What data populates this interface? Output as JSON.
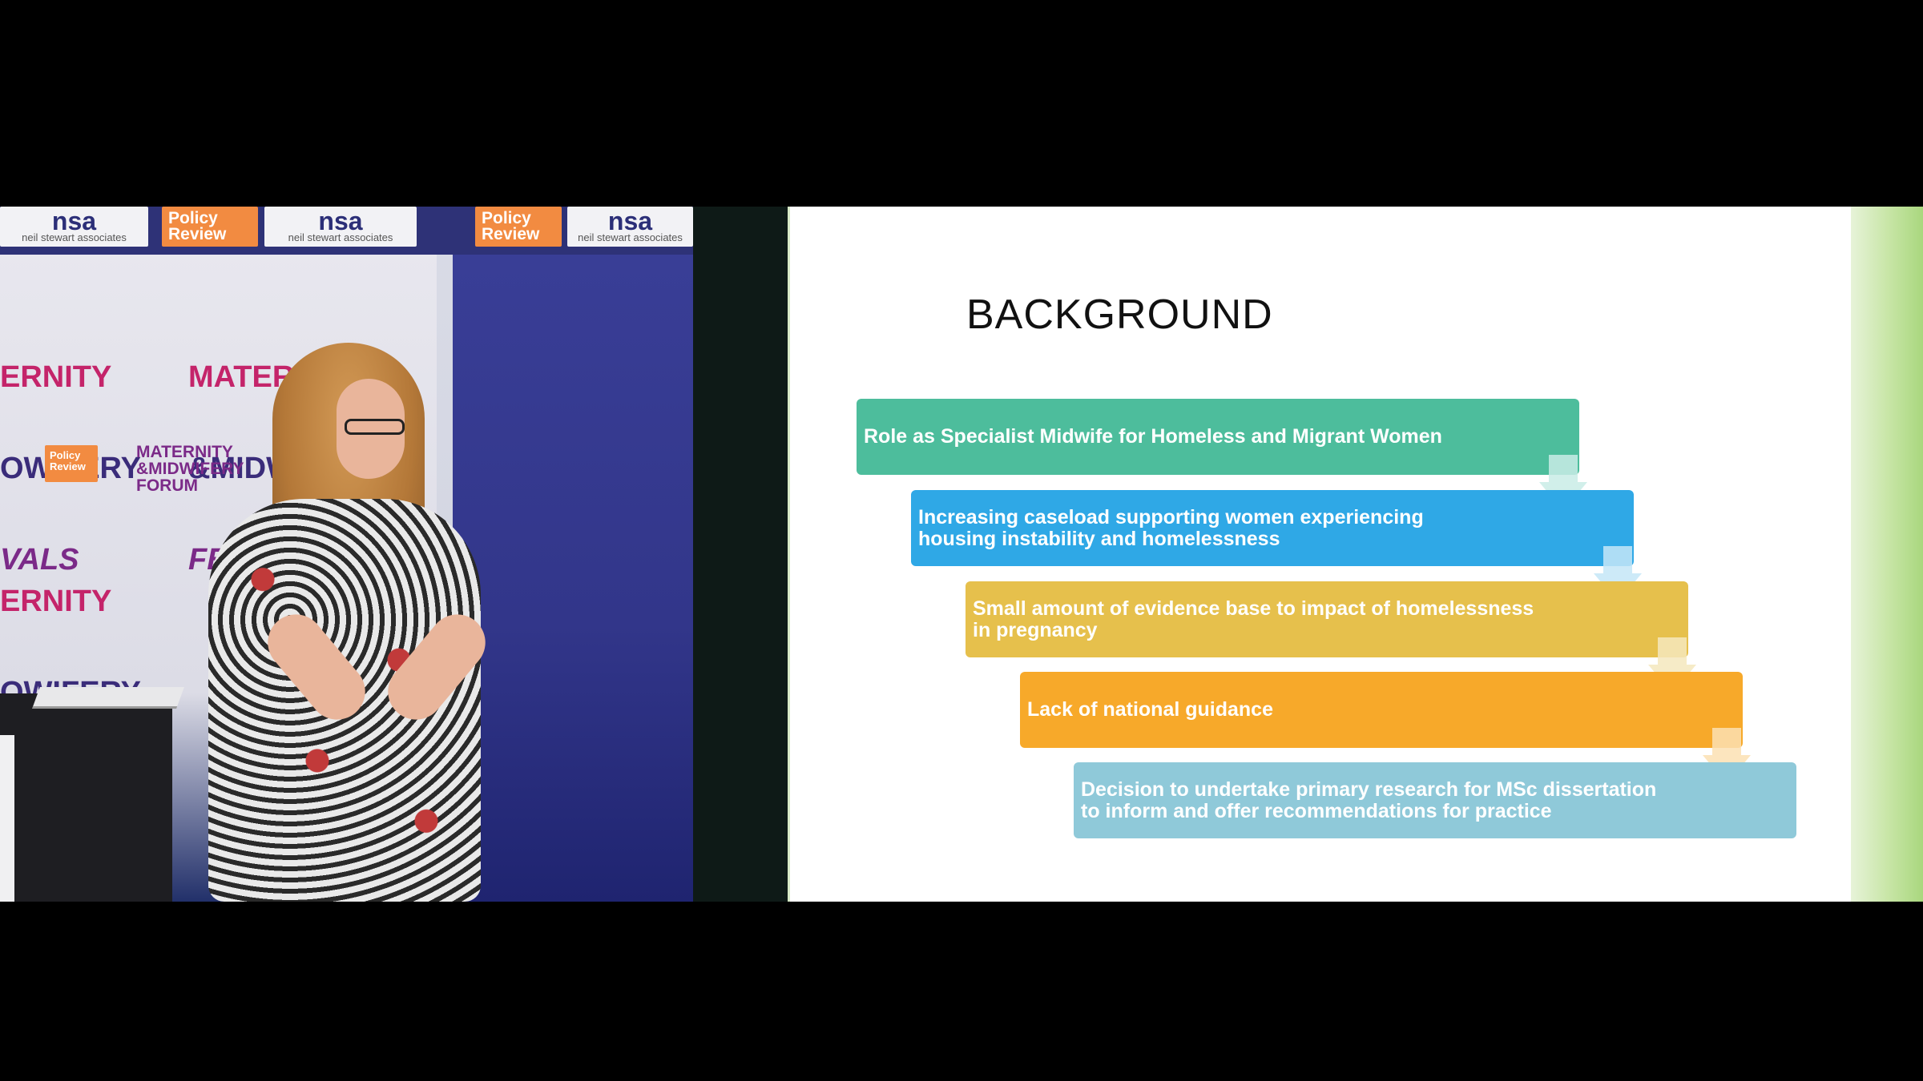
{
  "camera": {
    "sponsors": {
      "nsa_logo_text": "nsa",
      "nsa_logo_subtext": "neil stewart associates",
      "policy_logo_text": "Policy\nReview"
    },
    "backdrop": {
      "festival_line1": "ERNITY",
      "festival_line2": "OWIFERY",
      "festival_line3": "VALS",
      "festival_b_line1": "MATERNITY",
      "festival_b_line2": "&MIDWIFERY",
      "festival_b_line3": "FESTIVA",
      "forum_text": "MATERNITY\n&MIDWIFERY\nFORUM",
      "mini_policy_text": "Policy\nReview"
    }
  },
  "slide": {
    "title": "BACKGROUND",
    "steps": [
      {
        "text": "Role as Specialist Midwife for Homeless and Migrant Women",
        "color": "#4dbd9c"
      },
      {
        "text": "Increasing caseload supporting women experiencing\nhousing instability and homelessness",
        "color": "#2fa8e6"
      },
      {
        "text": "Small amount of evidence base to impact of homelessness\nin pregnancy",
        "color": "#e6c04c"
      },
      {
        "text": "Lack of national guidance",
        "color": "#f7a92a"
      },
      {
        "text": "Decision to undertake primary research for MSc dissertation\nto inform and offer recommendations for practice",
        "color": "#8fc9d9"
      }
    ],
    "arrow_colors": [
      "#c9ece6",
      "#c4e6f7",
      "#f5e7bd",
      "#fbe0b3"
    ]
  }
}
